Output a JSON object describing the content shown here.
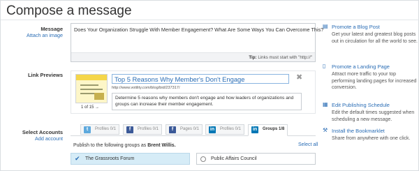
{
  "page": {
    "title": "Compose a message"
  },
  "message": {
    "label": "Message",
    "attach_link": "Attach an image",
    "text": "Does Your Organization Struggle With Member Engagement? What Are Some Ways You Can Overcome This?",
    "tip_label": "Tip:",
    "tip_text": "Links must start with \"http://\""
  },
  "link_preview": {
    "label": "Link Previews",
    "title": "Top 5 Reasons Why Member's Don't Engage",
    "url": "http://www.votility.com/blog/bid/237317/",
    "description": "Determine 5 reasons why members don't engage and how leaders of organizations and groups can increase their member engagement.",
    "pager": "1 of 15 →",
    "close_glyph": "✖"
  },
  "accounts": {
    "label": "Select Accounts",
    "add_link": "Add account",
    "tabs": [
      {
        "label": "Profiles 0/1",
        "icon": "twitter-icon",
        "glyph": "t",
        "color": "#5ea9dd",
        "active": false
      },
      {
        "label": "Profiles 0/1",
        "icon": "facebook-icon",
        "glyph": "f",
        "color": "#3b5998",
        "active": false
      },
      {
        "label": "Pages 0/1",
        "icon": "facebook-icon",
        "glyph": "f",
        "color": "#3b5998",
        "active": false
      },
      {
        "label": "Profiles 0/1",
        "icon": "linkedin-icon",
        "glyph": "in",
        "color": "#0077b5",
        "active": false
      },
      {
        "label": "Groups 1/8",
        "icon": "linkedin-icon",
        "glyph": "in",
        "color": "#0077b5",
        "active": true
      }
    ],
    "publish_to": "Publish to the following groups as",
    "publish_as": "Brent Willis.",
    "select_all": "Select all",
    "groups": [
      {
        "name": "The Grassroots Forum",
        "selected": true,
        "check_glyph": "✔"
      },
      {
        "name": "Public Affairs Council",
        "selected": false
      }
    ]
  },
  "sidebar": {
    "items": [
      {
        "title": "Promote a Blog Post",
        "icon": "blog-icon",
        "glyph": "▤",
        "desc": "Get your latest and greatest blog posts out in circulation for all the world to see."
      },
      {
        "title": "Promote a Landing Page",
        "icon": "page-icon",
        "glyph": "▯",
        "desc": "Attract more traffic to your top performing landing pages for increased conversion."
      },
      {
        "title": "Edit Publishing Schedule",
        "icon": "calendar-icon",
        "glyph": "▦",
        "desc": "Edit the default times suggested when scheduling a new message."
      },
      {
        "title": "Install the Bookmarklet",
        "icon": "bookmarklet-icon",
        "glyph": "⚒",
        "desc": "Share from anywhere with one click."
      }
    ]
  }
}
